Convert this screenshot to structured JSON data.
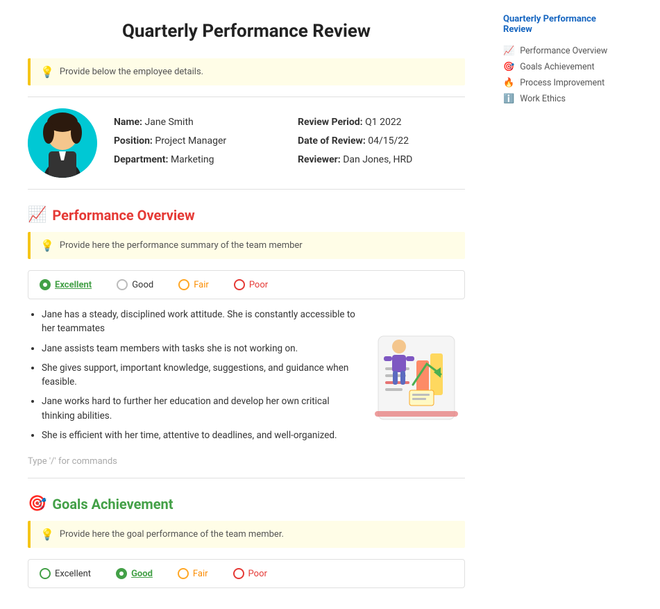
{
  "page": {
    "title": "Quarterly Performance Review"
  },
  "hint_employee": "Provide below the employee details.",
  "employee": {
    "name_label": "Name:",
    "name_value": "Jane Smith",
    "position_label": "Position:",
    "position_value": "Project Manager",
    "department_label": "Department:",
    "department_value": "Marketing",
    "review_period_label": "Review Period:",
    "review_period_value": "Q1 2022",
    "date_label": "Date of Review:",
    "date_value": "04/15/22",
    "reviewer_label": "Reviewer:",
    "reviewer_value": "Dan Jones, HRD"
  },
  "sections": {
    "performance": {
      "icon": "📈",
      "title": "Performance Overview",
      "hint": "Provide here the performance summary of the team member",
      "ratings": [
        {
          "label": "Excellent",
          "state": "selected",
          "color": "green"
        },
        {
          "label": "Good",
          "state": "unselected",
          "color": "gray"
        },
        {
          "label": "Fair",
          "state": "unselected",
          "color": "orange"
        },
        {
          "label": "Poor",
          "state": "unselected",
          "color": "red"
        }
      ],
      "bullets": [
        "Jane has a steady, disciplined work attitude. She is constantly accessible to her teammates",
        "Jane assists team members with tasks she is not working on.",
        "She gives support, important knowledge, suggestions, and guidance when feasible.",
        "Jane works hard to further her education and develop her own critical thinking abilities.",
        "She is efficient with her time, attentive to deadlines, and well-organized."
      ],
      "type_hint": "Type '/' for commands"
    },
    "goals": {
      "icon": "🎯",
      "title": "Goals Achievement",
      "hint": "Provide here the goal performance of the team member."
    }
  },
  "sidebar": {
    "title": "Quarterly Performance Review",
    "items": [
      {
        "icon": "📈",
        "label": "Performance Overview",
        "color": "#e91e63"
      },
      {
        "icon": "🎯",
        "label": "Goals Achievement",
        "color": "#f44336"
      },
      {
        "icon": "🔥",
        "label": "Process Improvement",
        "color": "#ff9800"
      },
      {
        "icon": "ℹ️",
        "label": "Work Ethics",
        "color": "#9e9e9e"
      }
    ]
  }
}
